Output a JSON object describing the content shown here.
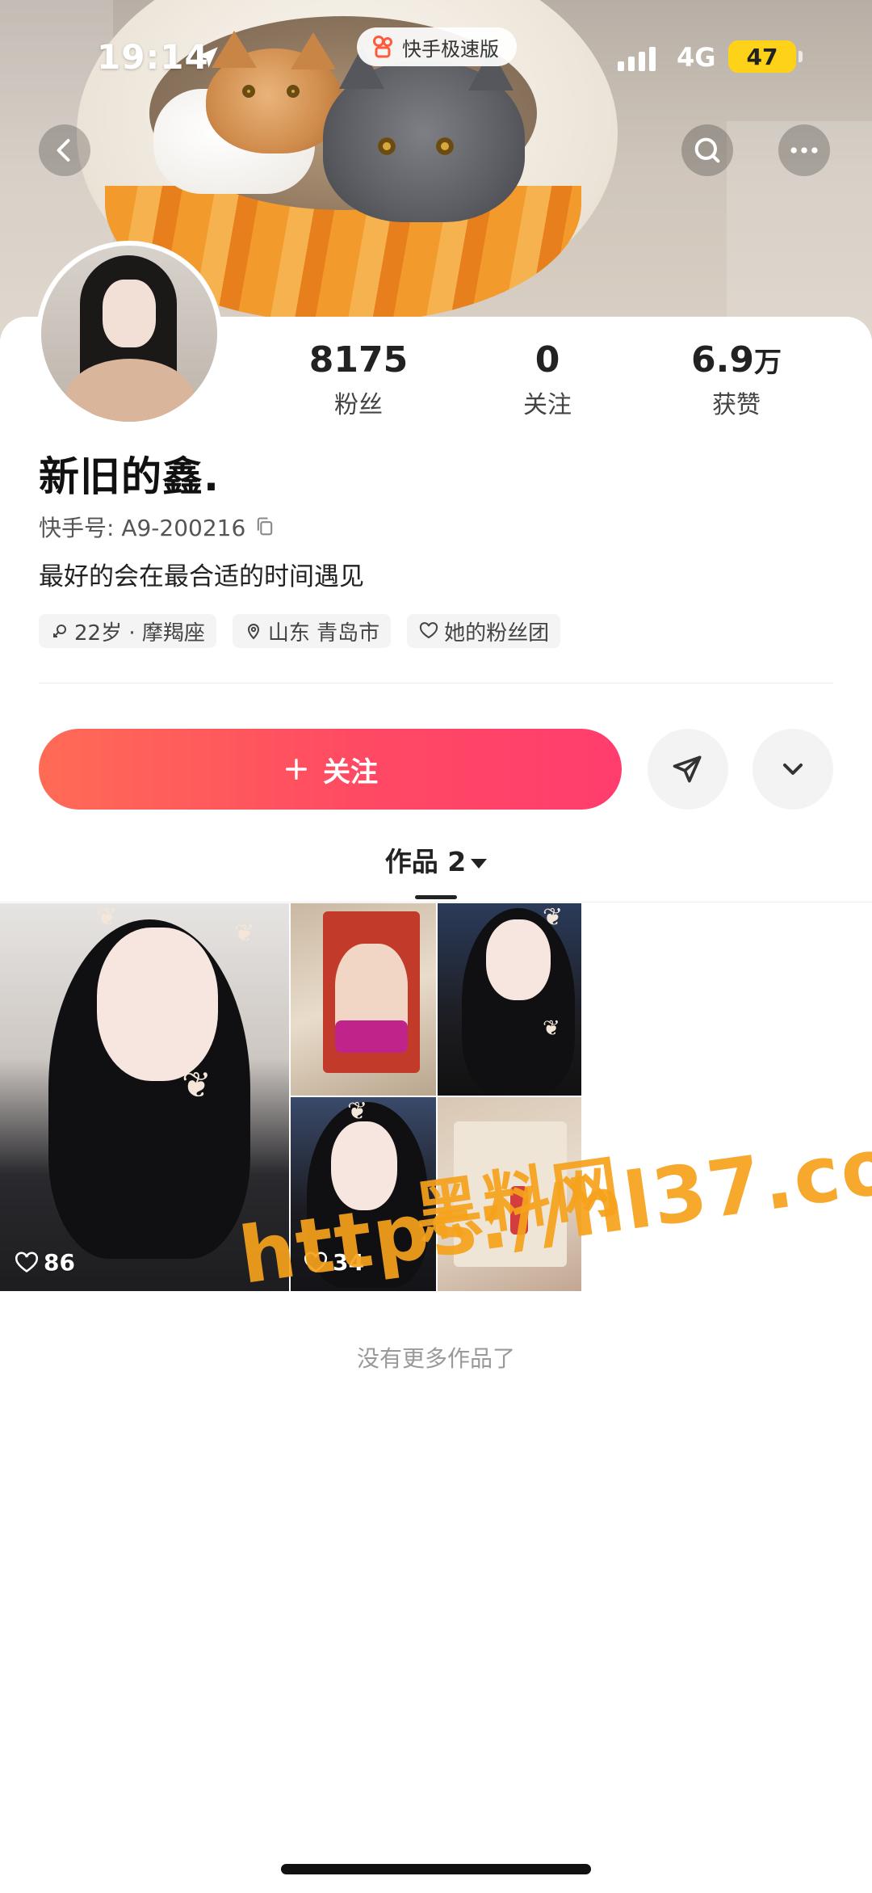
{
  "status_bar": {
    "time": "19:14",
    "app_name": "快手极速版",
    "network": "4G",
    "battery": "47"
  },
  "profile": {
    "name": "新旧的鑫.",
    "kuaishou_id_label": "快手号: A9-200216",
    "bio": "最好的会在最合适的时间遇见",
    "tags": [
      "22岁 · 摩羯座",
      "山东 青岛市",
      "她的粉丝团"
    ],
    "stats": [
      {
        "value": "8175",
        "unit": "",
        "label": "粉丝"
      },
      {
        "value": "0",
        "unit": "",
        "label": "关注"
      },
      {
        "value": "6.9",
        "unit": "万",
        "label": "获赞"
      }
    ]
  },
  "actions": {
    "follow_label": "关注"
  },
  "works": {
    "tab_label": "作品 2",
    "likes": [
      "86",
      "34"
    ],
    "footer": "没有更多作品了"
  },
  "watermark": {
    "text_cn": "黑料网",
    "url": "https://hl37.co"
  },
  "colors": {
    "follow_gradient_start": "#ff6b55",
    "follow_gradient_end": "#ff3d6e",
    "battery": "#ffd21a",
    "watermark": "#f6a21c"
  }
}
